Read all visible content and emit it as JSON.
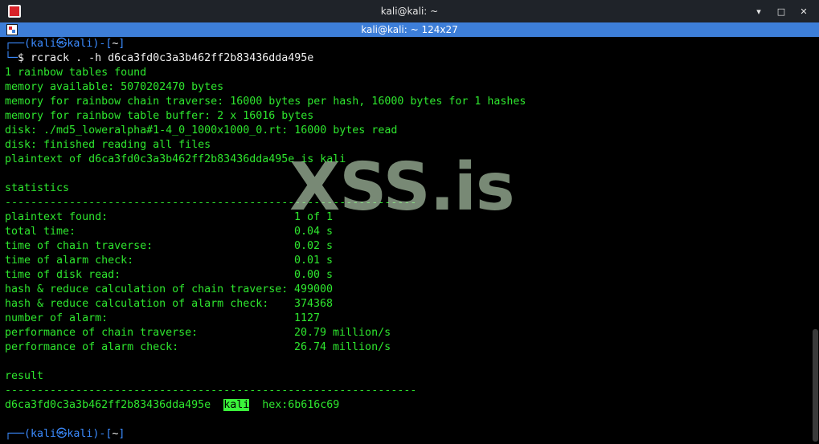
{
  "window": {
    "title": "kali@kali: ~",
    "controls": {
      "minimize": "▾",
      "maximize": "□",
      "close": "✕"
    }
  },
  "tab": {
    "title": "kali@kali: ~ 124x27"
  },
  "prompt": {
    "corner_top": "┌──(",
    "user": "kali㉿kali",
    "mid": ")-[",
    "dir": "~",
    "end": "]",
    "corner_bottom": "└─",
    "dollar": "$ "
  },
  "command": "rcrack . -h d6ca3fd0c3a3b462ff2b83436dda495e",
  "output": {
    "l1": "1 rainbow tables found",
    "l2": "memory available: 5070202470 bytes",
    "l3": "memory for rainbow chain traverse: 16000 bytes per hash, 16000 bytes for 1 hashes",
    "l4": "memory for rainbow table buffer: 2 x 16016 bytes",
    "l5": "disk: ./md5_loweralpha#1-4_0_1000x1000_0.rt: 16000 bytes read",
    "l6": "disk: finished reading all files",
    "l7": "plaintext of d6ca3fd0c3a3b462ff2b83436dda495e is kali"
  },
  "statistics": {
    "heading": "statistics",
    "separator": "----------------------------------------------------------------",
    "rows": [
      {
        "label": "plaintext found:",
        "value": "1 of 1"
      },
      {
        "label": "total time:",
        "value": "0.04 s"
      },
      {
        "label": "time of chain traverse:",
        "value": "0.02 s"
      },
      {
        "label": "time of alarm check:",
        "value": "0.01 s"
      },
      {
        "label": "time of disk read:",
        "value": "0.00 s"
      },
      {
        "label": "hash & reduce calculation of chain traverse:",
        "value": "499000"
      },
      {
        "label": "hash & reduce calculation of alarm check:",
        "value": "374368"
      },
      {
        "label": "number of alarm:",
        "value": "1127"
      },
      {
        "label": "performance of chain traverse:",
        "value": "20.79 million/s"
      },
      {
        "label": "performance of alarm check:",
        "value": "26.74 million/s"
      }
    ]
  },
  "result": {
    "heading": "result",
    "separator": "----------------------------------------------------------------",
    "hash": "d6ca3fd0c3a3b462ff2b83436dda495e",
    "plain": "kali",
    "hex": "hex:6b616c69"
  },
  "watermark": "XSS.is",
  "colors": {
    "terminal_bg": "#000000",
    "output_green": "#2ee62e",
    "prompt_blue": "#3b8bff",
    "tab_bar": "#3d7ed8",
    "title_bar": "#1f2329"
  }
}
